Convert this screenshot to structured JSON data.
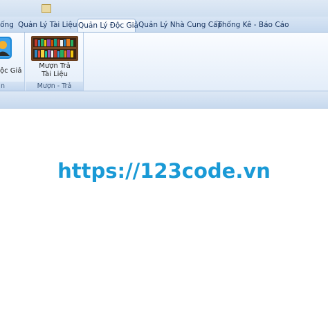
{
  "tabs": [
    {
      "label": "ống",
      "active": false
    },
    {
      "label": "Quản Lý Tài Liệu",
      "active": false
    },
    {
      "label": "Quản Lý Độc Giả",
      "active": true
    },
    {
      "label": "Quản Lý Nhà Cung Cấp",
      "active": false
    },
    {
      "label": "Thống Kê - Báo Cáo",
      "active": false
    }
  ],
  "ribbon": {
    "groups": [
      {
        "label": "n",
        "buttons": [
          {
            "label": "ộc Giả",
            "icon": "reader-icon"
          }
        ]
      },
      {
        "label": "Mượn - Trả",
        "buttons": [
          {
            "label_line1": "Mượn Trả",
            "label_line2": "Tài Liệu",
            "icon": "bookshelf-icon"
          }
        ]
      }
    ]
  },
  "watermark": {
    "text": "https://123code.vn",
    "color": "#1a9ad6"
  }
}
